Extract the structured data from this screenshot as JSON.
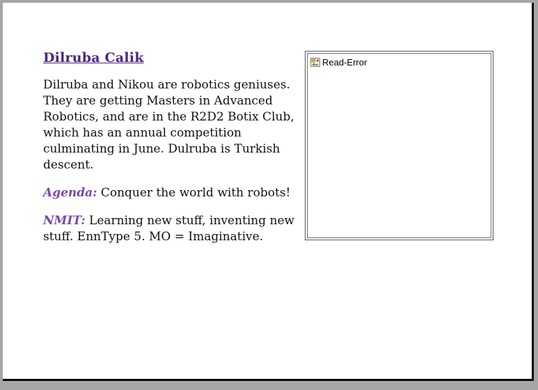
{
  "profile": {
    "name": "Dilruba Calik",
    "description": "Dilruba and Nikou are robotics geniuses. They  are getting Masters in Advanced Robotics, and are in the R2D2 Botix Club, which has an annual competition culminating in June. Dulruba is Turkish descent.",
    "agenda_label": "Agenda:",
    "agenda_text": " Conquer the world with robots!",
    "nmit_label": "NMIT:",
    "nmit_text": " Learning new stuff, inventing new stuff. EnnType 5. MO = Imaginative."
  },
  "image_placeholder": {
    "alt_text": "Read-Error",
    "icon": "broken-image-icon"
  },
  "colors": {
    "title": "#4b2584",
    "label": "#7b47b3",
    "frame": "#a6a6a6"
  }
}
